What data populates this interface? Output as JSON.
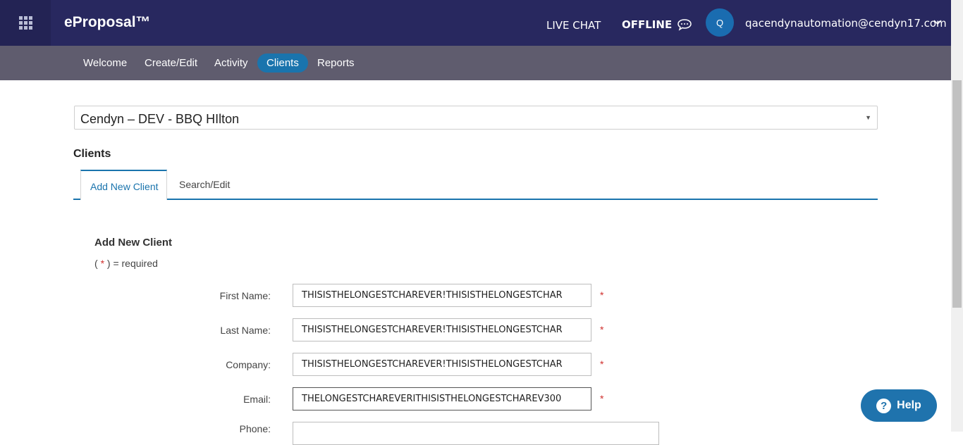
{
  "header": {
    "brand": "eProposal™",
    "live_chat": "LIVE CHAT",
    "offline": "OFFLINE",
    "avatar_initial": "Q",
    "user_email": "qacendynautomation@cendyn17.com"
  },
  "nav": {
    "items": [
      {
        "label": "Welcome"
      },
      {
        "label": "Create/Edit"
      },
      {
        "label": "Activity"
      },
      {
        "label": "Clients"
      },
      {
        "label": "Reports"
      }
    ],
    "active": "Clients"
  },
  "hotel_select": {
    "value": "Cendyn – DEV - BBQ HIlton"
  },
  "page": {
    "heading": "Clients"
  },
  "tabs": [
    {
      "label": "Add New Client"
    },
    {
      "label": "Search/Edit"
    }
  ],
  "form": {
    "title": "Add New Client",
    "required_note_open": "( ",
    "required_star": "*",
    "required_note_close": " ) = required",
    "fields": [
      {
        "label": "First Name:",
        "value": "THISISTHELONGESTCHAREVER!THISISTHELONGESTCHAR",
        "required": "*"
      },
      {
        "label": "Last Name:",
        "value": "THISISTHELONGESTCHAREVER!THISISTHELONGESTCHAR",
        "required": "*"
      },
      {
        "label": "Company:",
        "value": "THISISTHELONGESTCHAREVER!THISISTHELONGESTCHAR",
        "required": "*"
      },
      {
        "label": "Email:",
        "value": "THELONGESTCHAREVERITHISISTHELONGESTCHAREV300",
        "required": "*"
      },
      {
        "label": "Phone:",
        "value": ""
      }
    ]
  },
  "help": {
    "label": "Help",
    "icon": "?"
  },
  "colors": {
    "topbar": "#28285f",
    "navbar": "#5f5c6e",
    "accent": "#1a74ad",
    "required": "#d0302e"
  }
}
